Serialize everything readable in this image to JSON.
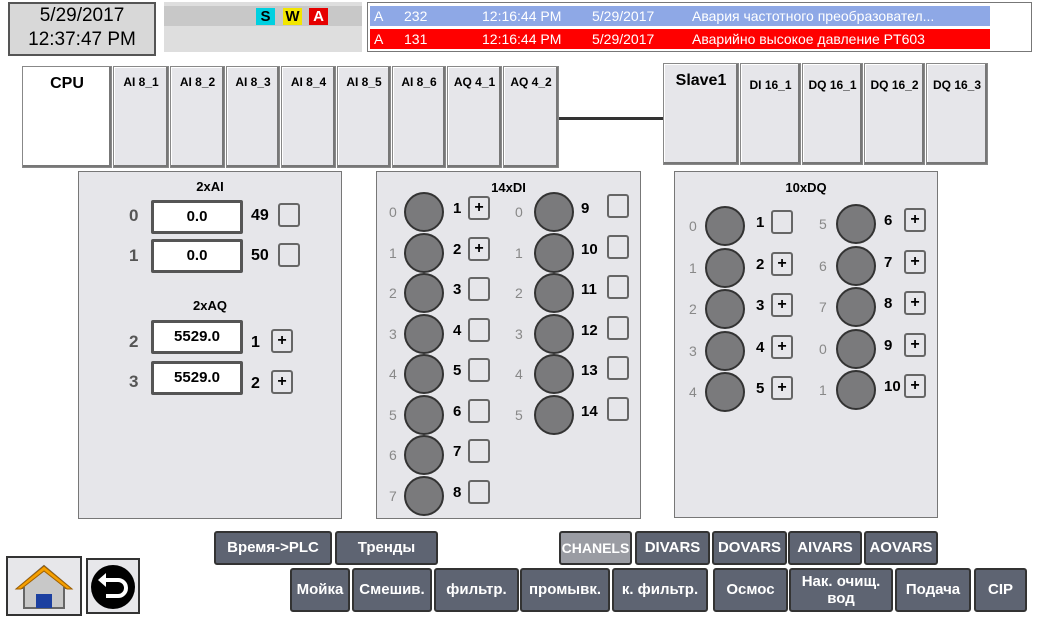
{
  "datetime": {
    "date": "5/29/2017",
    "time": "12:37:47 PM"
  },
  "indicators": {
    "s": {
      "label": "S",
      "color": "#00D0E0"
    },
    "w": {
      "label": "W",
      "color": "#F2E600"
    },
    "a": {
      "label": "A",
      "color": "#E60000"
    }
  },
  "alarms": [
    {
      "type": "A",
      "id": "232",
      "time": "12:16:44 PM",
      "date": "5/29/2017",
      "text": "Авария частотного преобразовател...",
      "color": "#8EA8E6"
    },
    {
      "type": "A",
      "id": "131",
      "time": "12:16:44 PM",
      "date": "5/29/2017",
      "text": "Аварийно высокое давление PT603",
      "color": "#FF0000"
    }
  ],
  "rack_main": [
    "CPU",
    "AI 8_1",
    "AI 8_2",
    "AI 8_3",
    "AI 8_4",
    "AI 8_5",
    "AI 8_6",
    "AQ 4_1",
    "AQ 4_2"
  ],
  "rack_slave": [
    "Slave1",
    "DI 16_1",
    "DQ 16_1",
    "DQ 16_2",
    "DQ 16_3"
  ],
  "ai_panel": {
    "title_ai": "2xAI",
    "title_aq": "2xAQ",
    "ai": [
      {
        "idx": "0",
        "value": "0.0",
        "num": "49"
      },
      {
        "idx": "1",
        "value": "0.0",
        "num": "50"
      }
    ],
    "aq": [
      {
        "idx": "2",
        "value": "5529.0",
        "num": "1",
        "mark": "+"
      },
      {
        "idx": "3",
        "value": "5529.0",
        "num": "2",
        "mark": "+"
      }
    ]
  },
  "di_panel": {
    "title": "14xDI",
    "left": [
      {
        "idx": "0",
        "num": "1",
        "mark": "+"
      },
      {
        "idx": "1",
        "num": "2",
        "mark": "+"
      },
      {
        "idx": "2",
        "num": "3",
        "mark": ""
      },
      {
        "idx": "3",
        "num": "4",
        "mark": ""
      },
      {
        "idx": "4",
        "num": "5",
        "mark": ""
      },
      {
        "idx": "5",
        "num": "6",
        "mark": ""
      },
      {
        "idx": "6",
        "num": "7",
        "mark": ""
      },
      {
        "idx": "7",
        "num": "8",
        "mark": ""
      }
    ],
    "right": [
      {
        "idx": "0",
        "num": "9",
        "mark": ""
      },
      {
        "idx": "1",
        "num": "10",
        "mark": ""
      },
      {
        "idx": "2",
        "num": "11",
        "mark": ""
      },
      {
        "idx": "3",
        "num": "12",
        "mark": ""
      },
      {
        "idx": "4",
        "num": "13",
        "mark": ""
      },
      {
        "idx": "5",
        "num": "14",
        "mark": ""
      }
    ]
  },
  "dq_panel": {
    "title": "10xDQ",
    "left": [
      {
        "idx": "0",
        "num": "1",
        "mark": ""
      },
      {
        "idx": "1",
        "num": "2",
        "mark": "+"
      },
      {
        "idx": "2",
        "num": "3",
        "mark": "+"
      },
      {
        "idx": "3",
        "num": "4",
        "mark": "+"
      },
      {
        "idx": "4",
        "num": "5",
        "mark": "+"
      }
    ],
    "right": [
      {
        "idx": "5",
        "num": "6",
        "mark": "+"
      },
      {
        "idx": "6",
        "num": "7",
        "mark": "+"
      },
      {
        "idx": "7",
        "num": "8",
        "mark": "+"
      },
      {
        "idx": "0",
        "num": "9",
        "mark": "+"
      },
      {
        "idx": "1",
        "num": "10",
        "mark": "+"
      }
    ]
  },
  "buttons_row1": [
    "Время->PLC",
    "Тренды"
  ],
  "buttons_tabs": [
    "CHANELS",
    "DIVARS",
    "DOVARS",
    "AIVARS",
    "AOVARS"
  ],
  "buttons_row2": [
    "Мойка",
    "Смешив.",
    "фильтр.",
    "промывк.",
    "к. фильтр.",
    "Осмос",
    "Нак. очищ. вод",
    "Подача",
    "CIP"
  ]
}
